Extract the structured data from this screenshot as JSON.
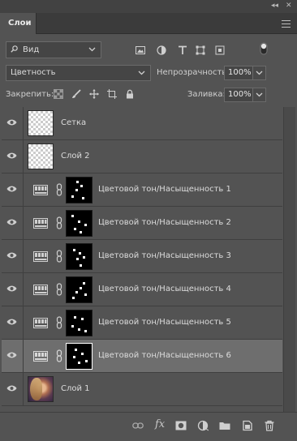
{
  "window": {
    "collapse_glyph": "◂◂",
    "close_glyph": "✕"
  },
  "panel": {
    "tab_label": "Слои"
  },
  "filter": {
    "kind_label": "Вид",
    "icons": [
      "image-filter-icon",
      "adjustment-filter-icon",
      "type-filter-icon",
      "shape-filter-icon",
      "smart-object-filter-icon"
    ]
  },
  "blend": {
    "mode": "Цветность",
    "opacity_label": "Непрозрачность:",
    "opacity_value": "100%"
  },
  "lock": {
    "label": "Закрепить:",
    "fill_label": "Заливка:",
    "fill_value": "100%"
  },
  "layers": [
    {
      "name": "Сетка",
      "kind": "pixel"
    },
    {
      "name": "Слой 2",
      "kind": "pixel"
    },
    {
      "name": "Цветовой тон/Насыщенность 1",
      "kind": "adjustment"
    },
    {
      "name": "Цветовой тон/Насыщенность 2",
      "kind": "adjustment"
    },
    {
      "name": "Цветовой тон/Насыщенность 3",
      "kind": "adjustment"
    },
    {
      "name": "Цветовой тон/Насыщенность 4",
      "kind": "adjustment"
    },
    {
      "name": "Цветовой тон/Насыщенность 5",
      "kind": "adjustment"
    },
    {
      "name": "Цветовой тон/Насыщенность 6",
      "kind": "adjustment",
      "selected": true
    },
    {
      "name": "Слой 1",
      "kind": "photo"
    }
  ],
  "bottom": {
    "fx_label": "fx"
  },
  "colors": {
    "panel_bg": "#535353",
    "selected_row": "#6e6e6e",
    "tab_bg": "#3b3b3b"
  }
}
